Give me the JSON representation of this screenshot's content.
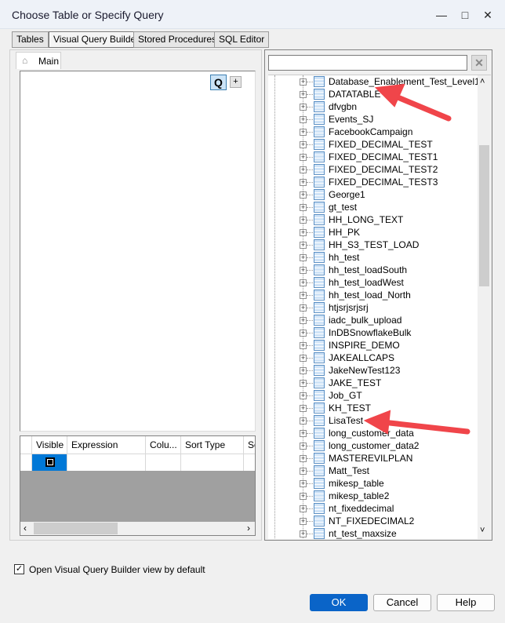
{
  "window": {
    "title": "Choose Table or Specify Query",
    "minimize": "—",
    "maximize": "□",
    "close": "✕"
  },
  "tabs": [
    "Tables",
    "Visual Query Builder",
    "Stored Procedures",
    "SQL Editor"
  ],
  "builder": {
    "main_tab": "Main",
    "q_button": "Q",
    "plus_button": "+"
  },
  "grid": {
    "columns": [
      "Visible",
      "Expression",
      "Colu...",
      "Sort Type",
      "So"
    ],
    "scroll_left": "‹",
    "scroll_right": "›"
  },
  "search": {
    "value": "",
    "clear": "✕"
  },
  "tree": {
    "items": [
      "Database_Enablement_Test_Level1",
      "DATATABLE",
      "dfvgbn",
      "Events_SJ",
      "FacebookCampaign",
      "FIXED_DECIMAL_TEST",
      "FIXED_DECIMAL_TEST1",
      "FIXED_DECIMAL_TEST2",
      "FIXED_DECIMAL_TEST3",
      "George1",
      "gt_test",
      "HH_LONG_TEXT",
      "HH_PK",
      "HH_S3_TEST_LOAD",
      "hh_test",
      "hh_test_loadSouth",
      "hh_test_loadWest",
      "hh_test_load_North",
      "htjsrjsrjsrj",
      "iadc_bulk_upload",
      "InDBSnowflakeBulk",
      "INSPIRE_DEMO",
      "JAKEALLCAPS",
      "JakeNewTest123",
      "JAKE_TEST",
      "Job_GT",
      "KH_TEST",
      "LisaTest",
      "long_customer_data",
      "long_customer_data2",
      "MASTEREVILPLAN",
      "Matt_Test",
      "mikesp_table",
      "mikesp_table2",
      "nt_fixeddecimal",
      "NT_FIXEDECIMAL2",
      "nt_test_maxsize"
    ],
    "scroll_up": "˄",
    "scroll_down": "˅"
  },
  "options": {
    "default_view_label": "Open Visual Query Builder view by default",
    "default_view_checked": true
  },
  "buttons": {
    "ok": "OK",
    "cancel": "Cancel",
    "help": "Help"
  },
  "colors": {
    "accent": "#0a64c8",
    "annotation_arrow": "#f0454a"
  }
}
